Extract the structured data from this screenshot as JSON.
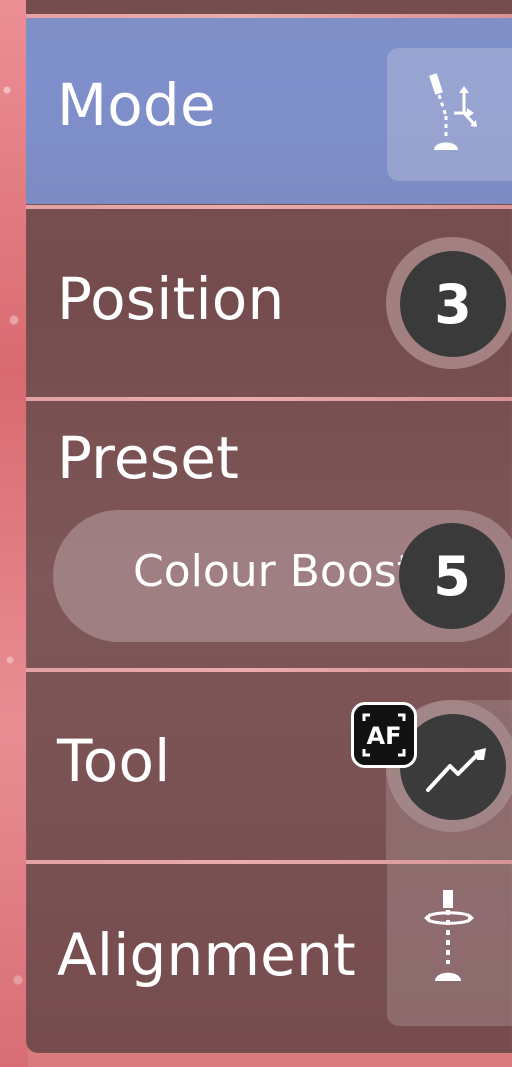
{
  "menu": {
    "mode": {
      "label": "Mode",
      "icon": "mode-icon"
    },
    "position": {
      "label": "Position",
      "value": "3"
    },
    "preset": {
      "label": "Preset",
      "selected": "Colour Boost",
      "value": "5"
    },
    "tool": {
      "label": "Tool",
      "badge": "AF",
      "icon": "tool-icon"
    },
    "alignment": {
      "label": "Alignment",
      "icon": "alignment-icon"
    }
  },
  "colors": {
    "active_row": "#7e8fcb",
    "panel": "#7d5455",
    "badge": "#3a3a3a",
    "text": "#ffffff",
    "divider": "#f0b1b1"
  }
}
